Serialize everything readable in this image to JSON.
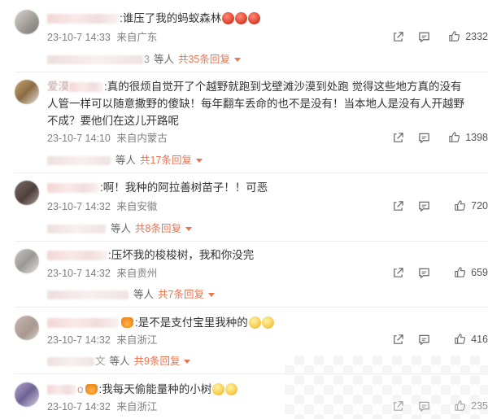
{
  "comments": [
    {
      "text": ":谁压了我的蚂蚁森林",
      "emojis": [
        "angry",
        "angry",
        "angry"
      ],
      "date": "23-10-7 14:33",
      "location": "来自广东",
      "likes": "2332",
      "reply_name_suffix": "3",
      "reply_deng": "等人",
      "reply_more": "共35条回复"
    },
    {
      "name_visible": "爱漠",
      "text": ":真的很烦自觉开了个越野就跑到戈壁滩沙漠到处跑 觉得这些地方真的没有人管一样可以随意撒野的傻缺！每年翻车丢命的也不是没有！当本地人是没有人开越野不成？要他们在这儿开路呢",
      "date": "23-10-7 14:10",
      "location": "来自内蒙古",
      "likes": "1398",
      "reply_deng": "等人",
      "reply_more": "共17条回复"
    },
    {
      "text": ":啊！我种的阿拉善树苗子！！可恶",
      "date": "23-10-7 14:32",
      "location": "来自安徽",
      "likes": "720",
      "reply_deng": "等人",
      "reply_more": "共8条回复"
    },
    {
      "text": ":压坏我的梭梭树，我和你没完",
      "date": "23-10-7 14:32",
      "location": "来自贵州",
      "likes": "659",
      "reply_deng": "等人",
      "reply_more": "共7条回复"
    },
    {
      "text": ":是不是支付宝里我种的",
      "emojis": [
        "wry",
        "wry"
      ],
      "date": "23-10-7 14:32",
      "location": "来自浙江",
      "likes": "416",
      "reply_name_suffix": "文",
      "reply_deng": "等人",
      "reply_more": "共9条回复"
    },
    {
      "name_suffix": "o",
      "text": ":我每天偷能量种的小树",
      "emojis": [
        "sad",
        "sad"
      ],
      "date": "23-10-7 14:32",
      "location": "来自浙江",
      "likes": "235"
    }
  ],
  "icons": {
    "share": "share-icon",
    "comment": "comment-icon",
    "like": "thumbs-up-icon",
    "expand": "chevron-down-icon"
  },
  "colors": {
    "reply_link": "#eb7350",
    "meta_text": "#808080",
    "body_text": "#333333"
  }
}
